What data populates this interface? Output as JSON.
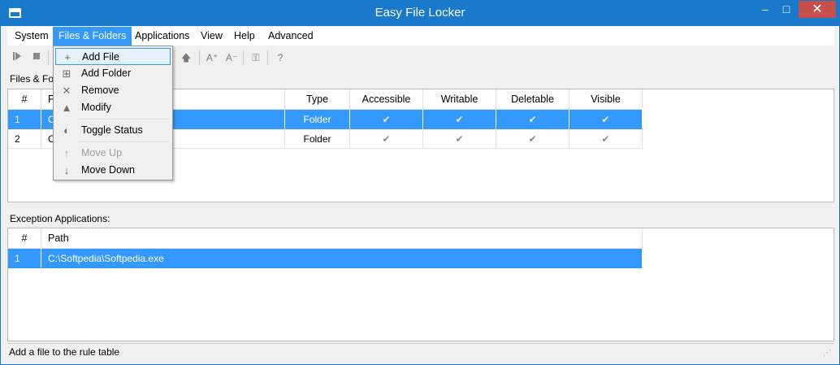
{
  "window": {
    "title": "Easy File Locker",
    "min": "–",
    "max": "□",
    "close": "✕"
  },
  "menubar": [
    {
      "label": "System"
    },
    {
      "label": "Files & Folders"
    },
    {
      "label": "Applications"
    },
    {
      "label": "View"
    },
    {
      "label": "Help"
    },
    {
      "label": "Advanced"
    }
  ],
  "toolbar": {
    "play_icon": "play-icon",
    "stop_icon": "stop-icon",
    "up_glyph": "🡅",
    "font_inc": "A⁺",
    "font_dec": "A⁻",
    "key_glyph": "⚿",
    "help_glyph": "?"
  },
  "files_section": {
    "label": "Files & Folders:"
  },
  "files_table": {
    "headers": [
      "#",
      "Path",
      "Type",
      "Accessible",
      "Writable",
      "Deletable",
      "Visible"
    ],
    "rows": [
      {
        "num": "1",
        "path": "C:\\Softpedia",
        "type": "Folder",
        "accessible": "✔",
        "writable": "✔",
        "deletable": "✔",
        "visible": "✔"
      },
      {
        "num": "2",
        "path": "C:\\Softpedia2",
        "type": "Folder",
        "accessible": "✔",
        "writable": "✔",
        "deletable": "✔",
        "visible": "✔"
      }
    ]
  },
  "exceptions_section": {
    "label": "Exception Applications:"
  },
  "exceptions_table": {
    "headers": [
      "#",
      "Path"
    ],
    "rows": [
      {
        "num": "1",
        "path": "C:\\Softpedia\\Softpedia.exe"
      }
    ]
  },
  "dropdown": {
    "items": [
      {
        "label": "Add File",
        "glyph": "+"
      },
      {
        "label": "Add Folder",
        "glyph": "⊞"
      },
      {
        "label": "Remove",
        "glyph": "✕"
      },
      {
        "label": "Modify",
        "glyph": "▲"
      },
      {
        "label": "Toggle Status",
        "glyph": "◐"
      },
      {
        "label": "Move Up",
        "glyph": "↑"
      },
      {
        "label": "Move Down",
        "glyph": "↓"
      }
    ]
  },
  "statusbar": {
    "text": "Add a file to the rule table"
  },
  "colors": {
    "titlebar": "#1979ca",
    "selection": "#3399ff",
    "close": "#c7504c"
  }
}
